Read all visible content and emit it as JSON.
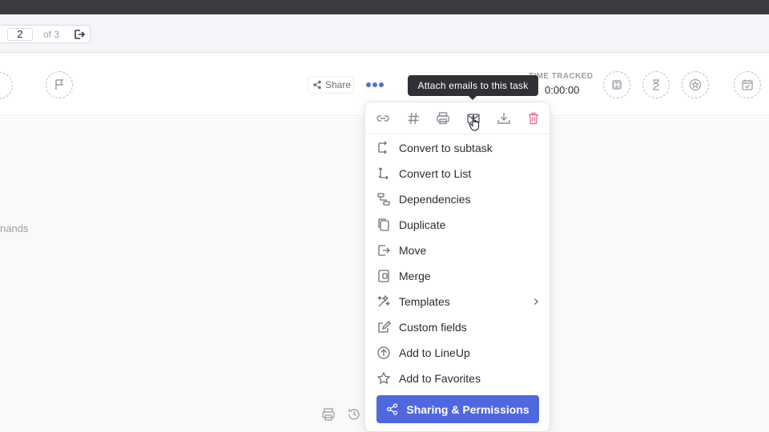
{
  "pager": {
    "current": "2",
    "of_label": "of 3"
  },
  "header": {
    "share_label": "Share",
    "time_tracked_label": "TIME TRACKED",
    "time_tracked_value": "0:00:00"
  },
  "tooltip": {
    "text": "Attach emails to this task"
  },
  "content": {
    "side_text": "nands"
  },
  "menu": {
    "icon_row": [
      "link-icon",
      "hash-icon",
      "print-icon",
      "email-icon",
      "import-icon",
      "trash-icon"
    ],
    "items": [
      {
        "label": "Convert to subtask",
        "icon": "subtask-icon"
      },
      {
        "label": "Convert to List",
        "icon": "list-convert-icon"
      },
      {
        "label": "Dependencies",
        "icon": "dependencies-icon"
      },
      {
        "label": "Duplicate",
        "icon": "duplicate-icon"
      },
      {
        "label": "Move",
        "icon": "move-icon"
      },
      {
        "label": "Merge",
        "icon": "merge-icon"
      },
      {
        "label": "Templates",
        "icon": "magic-wand-icon"
      },
      {
        "label": "Custom fields",
        "icon": "edit-icon"
      },
      {
        "label": "Add to LineUp",
        "icon": "arrow-up-circle-icon"
      },
      {
        "label": "Add to Favorites",
        "icon": "star-icon"
      }
    ],
    "primary_button": "Sharing & Permissions"
  },
  "colors": {
    "accent": "#4f67df",
    "tooltip_bg": "#2f3137",
    "danger": "#e86fa0"
  }
}
